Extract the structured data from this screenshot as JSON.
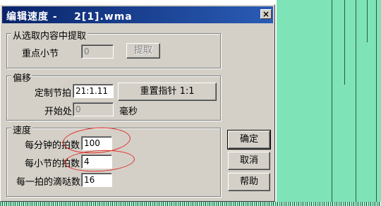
{
  "window": {
    "title": "编辑速度 -    2[1].wma",
    "close_glyph": "×"
  },
  "extract_group": {
    "label": "从选取内容中提取",
    "key_measure_label": "重点小节",
    "key_measure_value": "0",
    "extract_button": "提取"
  },
  "offset_group": {
    "label": "偏移",
    "custom_beat_label": "定制节拍",
    "custom_beat_value": "21:1.11",
    "reset_button": "重置指针 1:1",
    "start_label": "开始处",
    "start_value": "0",
    "start_unit": "毫秒"
  },
  "tempo_group": {
    "label": "速度",
    "bpm_label": "每分钟的拍数",
    "bpm_value": "100",
    "beats_per_measure_label": "每小节的拍数",
    "beats_per_measure_value": "4",
    "ticks_per_beat_label": "每一拍的滴哒数",
    "ticks_per_beat_value": "16"
  },
  "buttons": {
    "ok": "确定",
    "cancel": "取消",
    "help": "帮助"
  },
  "colors": {
    "annotation": "#e0302a",
    "titlebar": "#0a246a",
    "background_right": "#7fe3b8"
  }
}
